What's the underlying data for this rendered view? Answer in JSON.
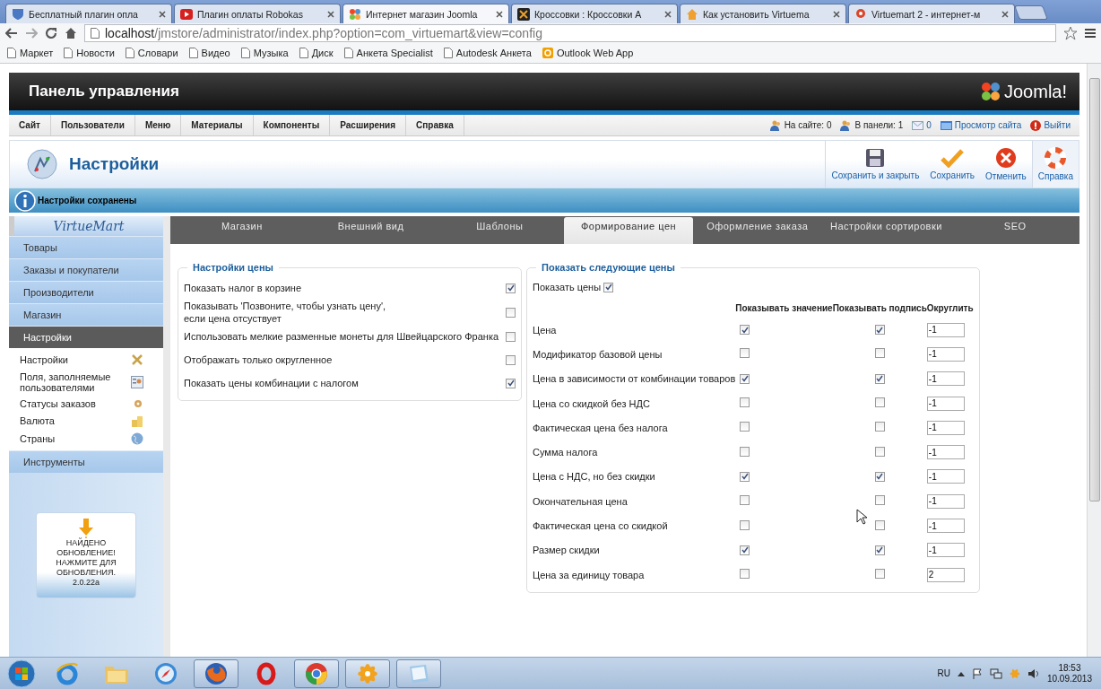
{
  "browser": {
    "tabs": [
      {
        "title": "Бесплатный плагин опла",
        "kind": "shield",
        "selected": false
      },
      {
        "title": "Плагин оплаты Robokas",
        "kind": "video",
        "selected": false
      },
      {
        "title": "Интернет магазин Joomla",
        "kind": "joomla",
        "selected": true
      },
      {
        "title": "Кроссовки : Кроссовки А",
        "kind": "square",
        "selected": false
      },
      {
        "title": "Как установить Virtuema",
        "kind": "home",
        "selected": false
      },
      {
        "title": "Virtuemart 2 - интернет-м",
        "kind": "pin",
        "selected": false
      }
    ],
    "address_host": "localhost",
    "address_path": "/jmstore/administrator/index.php?option=com_virtuemart&view=config",
    "bookmarks": [
      {
        "label": "Маркет",
        "kind": "page"
      },
      {
        "label": "Новости",
        "kind": "page"
      },
      {
        "label": "Словари",
        "kind": "page"
      },
      {
        "label": "Видео",
        "kind": "page"
      },
      {
        "label": "Музыка",
        "kind": "page"
      },
      {
        "label": "Диск",
        "kind": "page"
      },
      {
        "label": "Анкета Specialist",
        "kind": "page"
      },
      {
        "label": "Autodesk Анкета",
        "kind": "page"
      },
      {
        "label": "Outlook Web App",
        "kind": "outlook"
      }
    ]
  },
  "header": {
    "title": "Панель управления",
    "logo": "Joomla!"
  },
  "menu": [
    "Сайт",
    "Пользователи",
    "Меню",
    "Материалы",
    "Компоненты",
    "Расширения",
    "Справка"
  ],
  "status": [
    {
      "text": "На сайте: 0",
      "kind": "users",
      "link": false
    },
    {
      "text": "В панели: 1",
      "kind": "users",
      "link": false
    },
    {
      "text": "0",
      "kind": "mail",
      "link": true
    },
    {
      "text": "Просмотр сайта",
      "kind": "monitor",
      "link": true
    },
    {
      "text": "Выйти",
      "kind": "logout",
      "link": true
    }
  ],
  "toolbar": {
    "title": "Настройки",
    "buttons": [
      {
        "label": "Сохранить и закрыть",
        "kind": "save"
      },
      {
        "label": "Сохранить",
        "kind": "apply"
      },
      {
        "label": "Отменить",
        "kind": "cancel"
      },
      {
        "label": "Справка",
        "kind": "help"
      }
    ]
  },
  "message": "Настройки сохранены",
  "sidebar": {
    "logo": "VirtueMart",
    "items": [
      {
        "label": "Товары",
        "selected": false
      },
      {
        "label": "Заказы и покупатели",
        "selected": false
      },
      {
        "label": "Производители",
        "selected": false
      },
      {
        "label": "Магазин",
        "selected": false
      },
      {
        "label": "Настройки",
        "selected": true
      }
    ],
    "sub_items": [
      {
        "label": "Настройки",
        "kind": "tools"
      },
      {
        "label": "Поля, заполняемые пользователями",
        "kind": "fields"
      },
      {
        "label": "Статусы заказов",
        "kind": "status"
      },
      {
        "label": "Валюта",
        "kind": "currency"
      },
      {
        "label": "Страны",
        "kind": "globe"
      }
    ],
    "tools": "Инструменты",
    "update": {
      "message": "НАЙДЕНО ОБНОВЛЕНИЕ! НАЖМИТЕ ДЛЯ ОБНОВЛЕНИЯ.",
      "version": "2.0.22a"
    }
  },
  "tabs": [
    {
      "label": "Магазин",
      "selected": false
    },
    {
      "label": "Внешний вид",
      "selected": false
    },
    {
      "label": "Шаблоны",
      "selected": false
    },
    {
      "label": "Формирование цен",
      "selected": true
    },
    {
      "label": "Оформление заказа",
      "selected": false
    },
    {
      "label": "Настройки сортировки",
      "selected": false
    },
    {
      "label": "SEO",
      "selected": false
    }
  ],
  "price_settings": {
    "title": "Настройки цены",
    "rows": [
      {
        "label": "Показать налог в корзине",
        "checked": true
      },
      {
        "label": "Показывать 'Позвоните, чтобы узнать цену',\nесли цена отсуствует",
        "checked": false
      },
      {
        "label": "Использовать мелкие разменные монеты для Швейцарского Франка",
        "checked": false
      },
      {
        "label": "Отображать только округленное",
        "checked": false
      },
      {
        "label": "Показать цены комбинации с налогом",
        "checked": true
      }
    ]
  },
  "show_prices": {
    "title": "Показать следующие цены",
    "show_label": "Показать цены",
    "show_checked": true,
    "columns": [
      "Показывать значение",
      "Показывать подпись",
      "Округлить"
    ],
    "rows": [
      {
        "label": "Цена",
        "show_value": true,
        "show_label": true,
        "rounding": "-1"
      },
      {
        "label": "Модификатор базовой цены",
        "show_value": false,
        "show_label": false,
        "rounding": "-1"
      },
      {
        "label": "Цена в зависимости от комбинации товаров",
        "show_value": true,
        "show_label": true,
        "rounding": "-1"
      },
      {
        "label": "Цена со скидкой без НДС",
        "show_value": false,
        "show_label": false,
        "rounding": "-1"
      },
      {
        "label": "Фактическая цена без налога",
        "show_value": false,
        "show_label": false,
        "rounding": "-1"
      },
      {
        "label": "Сумма налога",
        "show_value": false,
        "show_label": false,
        "rounding": "-1"
      },
      {
        "label": "Цена с НДС, но без скидки",
        "show_value": true,
        "show_label": true,
        "rounding": "-1"
      },
      {
        "label": "Окончательная цена",
        "show_value": false,
        "show_label": false,
        "rounding": "-1"
      },
      {
        "label": "Фактическая цена со скидкой",
        "show_value": false,
        "show_label": false,
        "rounding": "-1"
      },
      {
        "label": "Размер скидки",
        "show_value": true,
        "show_label": true,
        "rounding": "-1"
      },
      {
        "label": "Цена за единицу товара",
        "show_value": false,
        "show_label": false,
        "rounding": "2"
      }
    ]
  },
  "taskbar": {
    "apps": [
      {
        "kind": "ie",
        "open": false
      },
      {
        "kind": "folder",
        "open": false
      },
      {
        "kind": "compass",
        "open": false
      },
      {
        "kind": "firefox",
        "open": true
      },
      {
        "kind": "opera",
        "open": false
      },
      {
        "kind": "chrome",
        "open": true
      },
      {
        "kind": "flower",
        "open": true
      },
      {
        "kind": "notes",
        "open": true
      }
    ],
    "language": "RU",
    "time": "18:53",
    "date": "10.09.2013"
  }
}
